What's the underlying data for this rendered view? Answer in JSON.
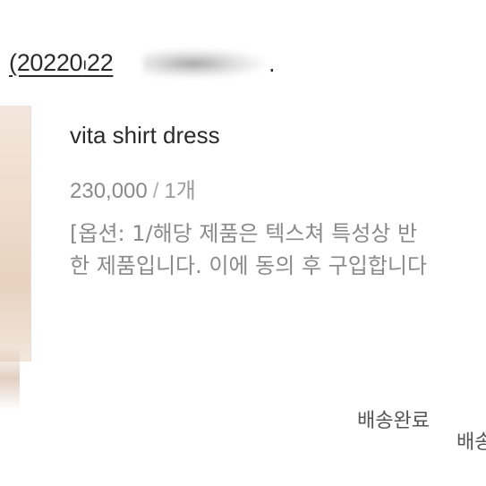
{
  "order": {
    "number_visible": "(20220",
    "number_cont": "22",
    "tail": "."
  },
  "product": {
    "name": "vita shirt dress",
    "price": "230,000",
    "separator": "/",
    "quantity": "1개",
    "option_line1": "[옵션: 1/해당 제품은 텍스쳐 특성상 반",
    "option_line2": "한 제품입니다. 이에 동의 후 구입합니다"
  },
  "status": {
    "primary": "배송완료",
    "secondary": "배송"
  }
}
